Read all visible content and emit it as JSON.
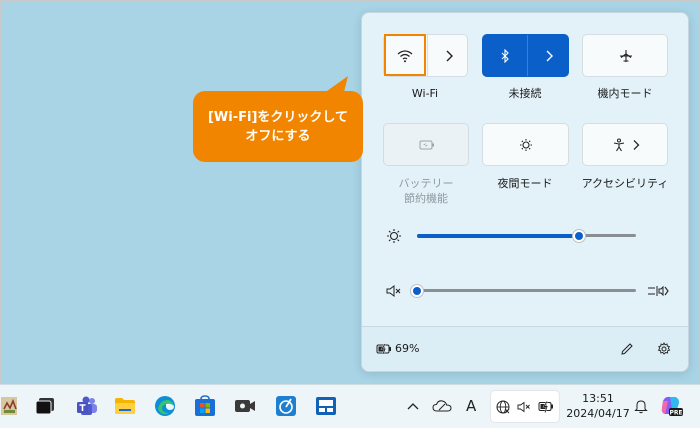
{
  "quick_settings": {
    "tiles": [
      {
        "label": "Wi-Fi"
      },
      {
        "label": "未接続"
      },
      {
        "label": "機内モード"
      },
      {
        "label_line1": "バッテリー",
        "label_line2": "節約機能"
      },
      {
        "label": "夜間モード"
      },
      {
        "label": "アクセシビリティ"
      }
    ],
    "brightness_level": 0.74,
    "volume_level": 0.0,
    "battery_text": "69%"
  },
  "callout": {
    "line1": "[Wi-Fi]をクリックして",
    "line2": "オフにする",
    "color": "#f28500"
  },
  "taskbar": {
    "time": "13:51",
    "date": "2024/04/17",
    "keyboard_indicator": "A",
    "accent_color": "#0a5fc9"
  }
}
